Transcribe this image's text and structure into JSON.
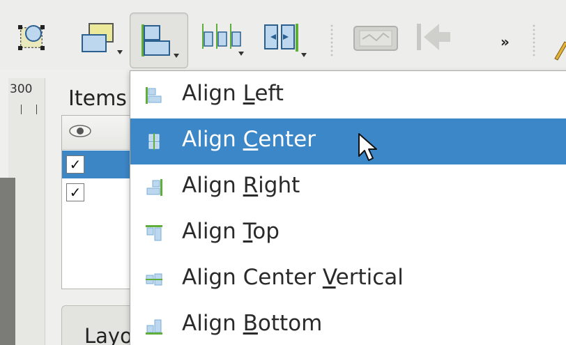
{
  "toolbar": {
    "buttons": [
      {
        "name": "select-items",
        "icon": "select-items-icon"
      },
      {
        "name": "raise-items",
        "icon": "raise-items-icon"
      },
      {
        "name": "align-items",
        "icon": "align-left-icon",
        "pressed": true
      },
      {
        "name": "distribute-items",
        "icon": "distribute-icon"
      },
      {
        "name": "resize-items",
        "icon": "resize-icon"
      },
      {
        "name": "atlas-preview",
        "icon": "atlas-icon"
      },
      {
        "name": "first-feature",
        "icon": "first-feature-icon"
      },
      {
        "name": "overflow",
        "icon": "overflow-chevron-icon",
        "label": "»"
      }
    ]
  },
  "panel": {
    "ruler_label": "300",
    "items_title": "Items",
    "rows": [
      {
        "checked": true,
        "selected": true,
        "check_glyph": "✓"
      },
      {
        "checked": true,
        "selected": false,
        "check_glyph": "✓"
      }
    ],
    "tab_label": "Layout"
  },
  "menu": {
    "items": [
      {
        "pre": "Align ",
        "mnemonic": "L",
        "post": "eft",
        "icon": "align-left-icon",
        "hovered": false
      },
      {
        "pre": "Align ",
        "mnemonic": "C",
        "post": "enter",
        "icon": "align-center-icon",
        "hovered": true
      },
      {
        "pre": "Align ",
        "mnemonic": "R",
        "post": "ight",
        "icon": "align-right-icon",
        "hovered": false
      },
      {
        "pre": "Align ",
        "mnemonic": "T",
        "post": "op",
        "icon": "align-top-icon",
        "hovered": false
      },
      {
        "pre": "Align Center ",
        "mnemonic": "V",
        "post": "ertical",
        "icon": "align-center-vertical-icon",
        "hovered": false
      },
      {
        "pre": "Align ",
        "mnemonic": "B",
        "post": "ottom",
        "icon": "align-bottom-icon",
        "hovered": false
      }
    ]
  },
  "colors": {
    "highlight": "#3c87c8",
    "icon_fill": "#bcd7ee",
    "icon_green": "#5fae3a"
  }
}
